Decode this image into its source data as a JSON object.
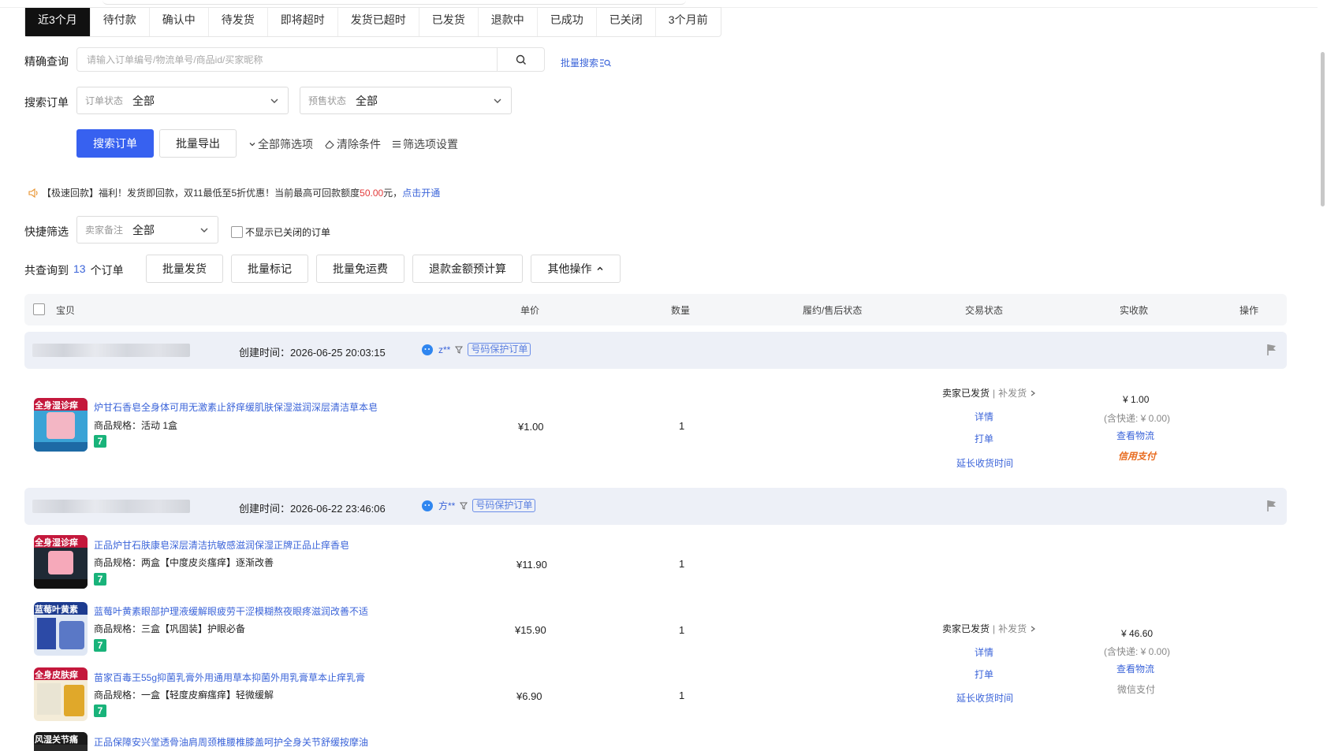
{
  "tabs": [
    "近3个月",
    "待付款",
    "确认中",
    "待发货",
    "即将超时",
    "发货已超时",
    "已发货",
    "退款中",
    "已成功",
    "已关闭",
    "3个月前"
  ],
  "precise": {
    "label": "精确查询",
    "placeholder": "请输入订单编号/物流单号/商品id/买家昵称",
    "batch_search": "批量搜索"
  },
  "filters": {
    "label": "搜索订单",
    "order_status": {
      "placeholder": "订单状态",
      "value": "全部"
    },
    "presale_status": {
      "placeholder": "预售状态",
      "value": "全部"
    }
  },
  "actions": {
    "search": "搜索订单",
    "export": "批量导出",
    "all_filters": "全部筛选项",
    "clear": "清除条件",
    "settings": "筛选项设置"
  },
  "notice": {
    "prefix": "【极速回款】福利！发货即回款，双11最低至5折优惠！当前最高可回款额度",
    "amount": "50.00",
    "suffix": "元，",
    "link": "点击开通"
  },
  "quick": {
    "label": "快捷筛选",
    "seller_note": {
      "placeholder": "卖家备注",
      "value": "全部"
    },
    "hide_closed": "不显示已关闭的订单"
  },
  "summary": {
    "prefix": "共查询到",
    "count": "13",
    "suffix": "个订单"
  },
  "bulk": {
    "ship": "批量发货",
    "mark": "批量标记",
    "free_shipping": "批量免运费",
    "refund_calc": "退款金额预计算",
    "more": "其他操作"
  },
  "columns": [
    "宝贝",
    "单价",
    "数量",
    "履约/售后状态",
    "交易状态",
    "实收款",
    "操作"
  ],
  "orders": [
    {
      "created_label": "创建时间：",
      "created": "2026-06-25 20:03:15",
      "buyer": "z**",
      "tag": "号码保护订单",
      "items": [
        {
          "title": "炉甘石香皂全身体可用无激素止舒痒缓肌肤保湿滋润深层清洁草本皂",
          "spec": "商品规格：活动 1盒",
          "price": "¥1.00",
          "qty": "1",
          "thumb_text": "全身湿诊痒"
        }
      ],
      "trade": {
        "status": "卖家已发货",
        "sub": "补发货",
        "detail": "详情",
        "print": "打单",
        "extend": "延长收货时间"
      },
      "pay": {
        "amount": "¥ 1.00",
        "shipping": "(含快递: ¥ 0.00)",
        "logistics": "查看物流",
        "method": "信用支付"
      }
    },
    {
      "created_label": "创建时间：",
      "created": "2026-06-22 23:46:06",
      "buyer": "方**",
      "tag": "号码保护订单",
      "items": [
        {
          "title": "正品炉甘石肤康皂深层清洁抗敏感滋润保湿正牌正品止痒香皂",
          "spec": "商品规格：两盒【中度皮炎瘙痒】逐渐改善",
          "price": "¥11.90",
          "qty": "1",
          "thumb_text": "全身湿诊痒"
        },
        {
          "title": "蓝莓叶黄素眼部护理液缓解眼疲劳干涩模糊熬夜眼疼滋润改善不适",
          "spec": "商品规格：三盒【巩固装】护眼必备",
          "price": "¥15.90",
          "qty": "1",
          "thumb_text": "蓝莓叶黄素"
        },
        {
          "title": "苗家百毒王55g抑菌乳膏外用通用草本抑菌外用乳膏草本止痒乳膏",
          "spec": "商品规格：一盒【轻度皮癣瘙痒】轻微缓解",
          "price": "¥6.90",
          "qty": "1",
          "thumb_text": "全身皮肤痒"
        },
        {
          "title": "正品保障安兴堂透骨油肩周颈椎腰椎膝盖呵护全身关节舒缓按摩油",
          "spec": "",
          "price": "",
          "qty": "",
          "thumb_text": "风湿关节痛"
        }
      ],
      "trade": {
        "status": "卖家已发货",
        "sub": "补发货",
        "detail": "详情",
        "print": "打单",
        "extend": "延长收货时间"
      },
      "pay": {
        "amount": "¥ 46.60",
        "shipping": "(含快递: ¥ 0.00)",
        "logistics": "查看物流",
        "method": "微信支付"
      }
    }
  ],
  "colors": {
    "primary": "#3761f0",
    "link": "#3b64d9",
    "notice_red": "#e23b3b",
    "credit_orange": "#e86b1f"
  }
}
